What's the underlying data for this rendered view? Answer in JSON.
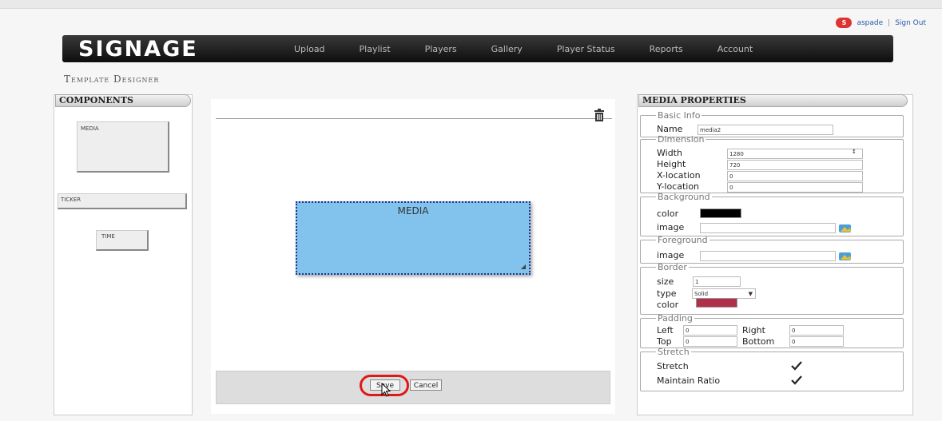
{
  "user": {
    "badge": "S",
    "name": "aspade",
    "separator": "|",
    "signout": "Sign Out"
  },
  "brand": {
    "logo": "SIGNAGE"
  },
  "nav": [
    "Upload",
    "Playlist",
    "Players",
    "Gallery",
    "Player Status",
    "Reports",
    "Account"
  ],
  "page": {
    "title": "Template Designer"
  },
  "components": {
    "header": "COMPONENTS",
    "items": [
      "MEDIA",
      "TICKER",
      "TIME"
    ]
  },
  "canvas": {
    "media_label": "MEDIA",
    "save_label": "Save",
    "cancel_label": "Cancel"
  },
  "properties": {
    "header": "MEDIA PROPERTIES",
    "basic": {
      "legend": "Basic Info",
      "name_label": "Name",
      "name_value": "media2"
    },
    "dimension": {
      "legend": "Dimension",
      "width_label": "Width",
      "width_value": "1280",
      "height_label": "Height",
      "height_value": "720",
      "x_label": "X-location",
      "x_value": "0",
      "y_label": "Y-location",
      "y_value": "0"
    },
    "background": {
      "legend": "Background",
      "color_label": "color",
      "image_label": "image",
      "color_value": "#000000"
    },
    "foreground": {
      "legend": "Foreground",
      "image_label": "image"
    },
    "border": {
      "legend": "Border",
      "size_label": "size",
      "size_value": "1",
      "type_label": "type",
      "type_value": "Solid",
      "color_label": "color",
      "color_value": "#b0304a"
    },
    "padding": {
      "legend": "Padding",
      "left_label": "Left",
      "left_value": "0",
      "right_label": "Right",
      "right_value": "0",
      "top_label": "Top",
      "top_value": "0",
      "bottom_label": "Bottom",
      "bottom_value": "0"
    },
    "stretch": {
      "legend": "Stretch",
      "stretch_label": "Stretch",
      "stretch_checked": true,
      "ratio_label": "Maintain Ratio",
      "ratio_checked": true
    }
  },
  "colors": {
    "media_fill": "#82c3ed",
    "highlight": "#e01818",
    "navbar": "#1a1a1a"
  }
}
